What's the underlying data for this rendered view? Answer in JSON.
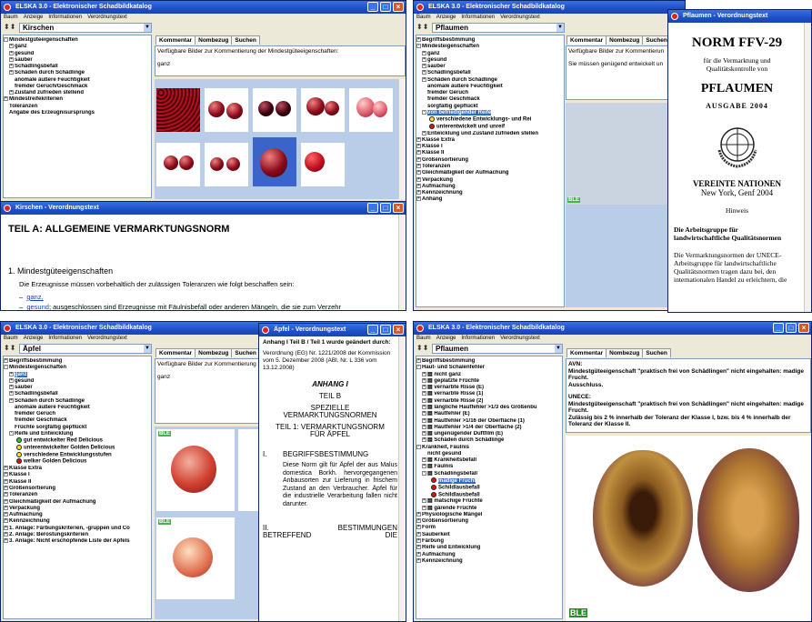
{
  "title_main": "ELSKA 3.0 - Elektronischer Schadbildkatalog",
  "menu": [
    "Baum",
    "Anzeige",
    "Informationen",
    "Verordnungstext"
  ],
  "tabs": [
    "Kommentar",
    "Nombezug",
    "Suchen"
  ],
  "tl": {
    "select": "Kirschen",
    "comment_label": "Verfügbare Bilder zur Kommentierung der Mindestgüteeigenschaften:",
    "comment_value": "ganz",
    "tree": [
      "Mindestgüteeigenschaften",
      "ganz",
      "gesund",
      "sauber",
      "Schädlingsbefall",
      "Schäden durch Schädlinge",
      "anomale äußere Feuchtigkeit",
      "fremder Geruch/Geschmack",
      "Zustand zufrieden stellend",
      "Mindestreifekriterien",
      "Toleranzen",
      "Angabe des Erzeugnisursprungs"
    ]
  },
  "kirsch": {
    "title": "Kirschen - Verordnungstext",
    "heading": "TEIL A:   ALLGEMEINE VERMARKTUNGSNORM",
    "section": "1. Mindestgüteeigenschaften",
    "intro": "Die Erzeugnisse müssen vorbehaltlich der zulässigen Toleranzen wie folgt beschaffen sein:",
    "b1": "ganz,",
    "b2a": "gesund",
    "b2b": "; ausgeschlossen sind Erzeugnisse mit Fäulnisbefall oder anderen Mängeln, die sie zum Verzehr"
  },
  "tr": {
    "select": "Pflaumen",
    "comment_label": "Verfügbare Bilder zur Kommentierun",
    "comment_value": "Sie müssen genügend entwickelt un",
    "tree": [
      "Begriffsbestimmung",
      "Mindesteigenschaften",
      "ganz",
      "gesund",
      "sauber",
      "Schädlingsbefall",
      "Schäden durch Schädlinge",
      "anomale äußere Feuchtigkeit",
      "fremder Geruch",
      "fremder Geschmack",
      "sorgfältig gepflückt",
      "von befriedigender Reife",
      "verschiedene Entwicklungs- und Rei",
      "unterentwickelt und unreif",
      "Entwicklung und Zustand zufrieden stellen",
      "Klasse Extra",
      "Klasse I",
      "Klasse II",
      "Größensortierung",
      "Toleranzen",
      "Gleichmäßigkeit der Aufmachung",
      "Verpackung",
      "Aufmachung",
      "Kennzeichnung",
      "Anhang"
    ]
  },
  "pflnorm": {
    "title": "Pflaumen - Verordnungstext",
    "norm": "NORM FFV-29",
    "l1": "für die Vermarktung und",
    "l2": "Qualitätskontrolle von",
    "product": "PFLAUMEN",
    "edition": "AUSGABE 2004",
    "org": "VEREINTE NATIONEN",
    "place": "New York, Genf 2004",
    "hinweis": "Hinweis",
    "wg1": "Die Arbeitsgruppe für",
    "wg2": "landwirtschaftliche Qualitätsnormen",
    "p1": "Die Vermarktungsnormen der UNECE-",
    "p2": "Arbeitsgruppe für landwirtschaftliche",
    "p3": "Qualitätsnormen tragen dazu bei, den",
    "p4": "internationalen Handel zu erleichtern, die"
  },
  "bl": {
    "select": "Äpfel",
    "comment_label": "Verfügbare Bilder zur Kommentierung",
    "comment_value": "ganz",
    "tree": [
      "Begriffsbestimmung",
      "Mindesteigenschaften",
      "ganz",
      "gesund",
      "sauber",
      "Schädlingsbefall",
      "Schäden durch Schädlinge",
      "anomale äußere Feuchtigkeit",
      "fremder Geruch",
      "fremder Geschmack",
      "Früchte sorgfältig gepflückt",
      "Reife und Entwicklung",
      "gut entwickelter Red Delicious",
      "unterentwickelter Golden Delicious",
      "verschiedene Entwicklungsstufen",
      "welker Golden Delicious",
      "Klasse Extra",
      "Klasse I",
      "Klasse II",
      "Größensortierung",
      "Toleranzen",
      "Gleichmäßigkeit der Aufmachung",
      "Verpackung",
      "Aufmachung",
      "Kennzeichnung",
      "1. Anlage: Färbungskriterien, -gruppen und Co",
      "2. Anlage: Berostungskriterien",
      "3. Anlage: Nicht erschöpfende Liste der Apfels"
    ]
  },
  "apfel": {
    "title": "Äpfel - Verordnungstext",
    "h1": "Anhang I Teil B / Teil 1 wurde geändert durch:",
    "h2": "Verordnung (EG) Nr. 1221/2008 der Kommission",
    "h3": "vom 5. Dezember 2008 (ABl. Nr. L 336 vom 13.12.2008)",
    "anhang": "ANHANG I",
    "teil": "TEIL B",
    "spez1": "SPEZIELLE",
    "spez2": "VERMARKTUNGSNORMEN",
    "t1a": "TEIL 1: VERMARKTUNGSNORM",
    "t1b": "FÜR ÄPFEL",
    "sec1": "I.",
    "sec1t": "BEGRIFFSBESTIMMUNG",
    "body": "Diese Norm gilt für Äpfel der aus Malus domestica Borkh. hervorgegangenen Anbausorten zur Lieferung in frischem Zustand an den Verbraucher. Äpfel für die industrielle Verarbeitung fallen nicht darunter.",
    "sec2": "II.",
    "sec2t": "BESTIMMUNGEN",
    "sec2b": "BETREFFEND",
    "sec2c": "DIE"
  },
  "br": {
    "select": "Pflaumen",
    "avn_title": "AVN:",
    "avn_text": "Mindestgüteeigenschaft \"praktisch frei von Schädlingen\" nicht eingehalten: madige Frucht.",
    "avn_aus": "Ausschluss.",
    "unece_title": "UNECE:",
    "unece_text": "Mindestgüteeigenschaft \"praktisch frei von Schädlingen\" nicht eingehalten: madige Frucht.",
    "unece_tol": "Zulässig bis 2 % innerhalb der Toleranz der Klasse I, bzw. bis 4 % innerhalb der Toleranz der Klasse II.",
    "tree": [
      "Begriffsbestimmung",
      "Haut- und Schalenfehler",
      "nicht ganz",
      "geplatzte Früchte",
      "vernarbte Risse (E)",
      "vernarbte Risse (1)",
      "vernarbte Risse (2)",
      "längliche Hautfehler >1/3 des Größenbu",
      "Hautfehler (E)",
      "Hautfehler >1/16 der Oberfläche (1)",
      "Hautfehler >1/4 der Oberfläche (2)",
      "ungenügender Duftfilm (E)",
      "Schäden durch Schädlinge",
      "Krankheit, Fäulnis",
      "nicht gesund",
      "Krankheitsbefall",
      "Fäulnis",
      "Schädlingsbefall",
      "madige Frucht",
      "Schildlausbefall",
      "Schildlausbefall",
      "matschige Früchte",
      "gärende Früchte",
      "Physiologische Mängel",
      "Größensortierung",
      "Form",
      "Sauberkeit",
      "Färbung",
      "Reife und Entwicklung",
      "Aufmachung",
      "Kennzeichnung"
    ]
  },
  "ble_label": "BLE"
}
